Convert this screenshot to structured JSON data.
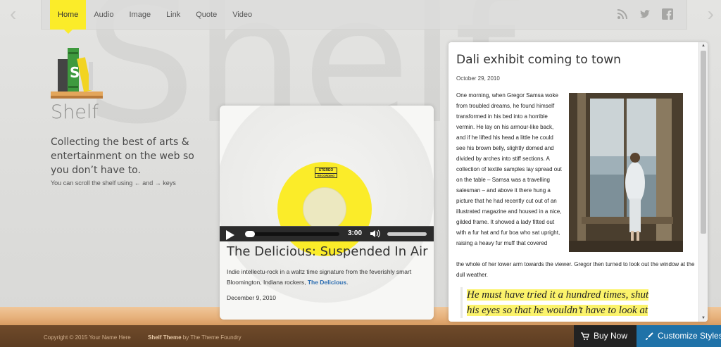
{
  "background_word": "Shelf",
  "nav": {
    "items": [
      {
        "label": "Home"
      },
      {
        "label": "Audio"
      },
      {
        "label": "Image"
      },
      {
        "label": "Link"
      },
      {
        "label": "Quote"
      },
      {
        "label": "Video"
      }
    ],
    "active": "Home",
    "social_icons": [
      "rss-icon",
      "twitter-icon",
      "facebook-icon"
    ]
  },
  "site": {
    "title": "Shelf",
    "description": "Collecting the best of arts & entertainment on the web so you don’t have to.",
    "scroll_hint": "You can scroll the shelf using ← and → keys"
  },
  "audio_post": {
    "record_label_top": "STEREO",
    "record_label_bottom": "RECORDING",
    "player_time": "3:00",
    "progress_fraction": 0.0,
    "title": "The Delicious: Suspended In Air",
    "desc_before": "Indie intellectu-rock in a waltz time signature from the feverishly smart Bloomington, Indiana rockers, ",
    "desc_link": "The Delicious",
    "desc_after": ".",
    "date": "December 9, 2010"
  },
  "article_post": {
    "title": "Dali exhibit coming to town",
    "date": "October 29, 2010",
    "body_side": "One morning, when Gregor Samsa woke from troubled dreams, he found himself transformed in his bed into a horrible vermin. He lay on his armour-like back, and if he lifted his head a little he could see his brown belly, slightly domed and divided by arches into stiff sections. A collection of textile samples lay spread out on the table – Samsa was a travelling salesman – and above it there hung a picture that he had recently cut out of an illustrated magazine and housed in a nice, gilded frame. It showed a lady fitted out with a fur hat and fur boa who sat upright, raising a heavy fur muff that covered",
    "body_full": "the whole of her lower arm towards the viewer. Gregor then turned to look out the window at the dull weather.",
    "quote_line1": "He must have tried it a hundred times, shut",
    "quote_line2": "his eyes so that he wouldn’t have to look at"
  },
  "footer": {
    "copyright": "Copyright © 2015 Your Name Here",
    "theme_name": "Shelf Theme",
    "theme_by": " by ",
    "theme_author": "The Theme Foundry"
  },
  "buttons": {
    "buy_now": "Buy Now",
    "customize": "Customize Styles"
  },
  "colors": {
    "accent_yellow": "#fbec29",
    "customize_blue": "#1f72a8",
    "link_blue": "#2a6cb0"
  }
}
